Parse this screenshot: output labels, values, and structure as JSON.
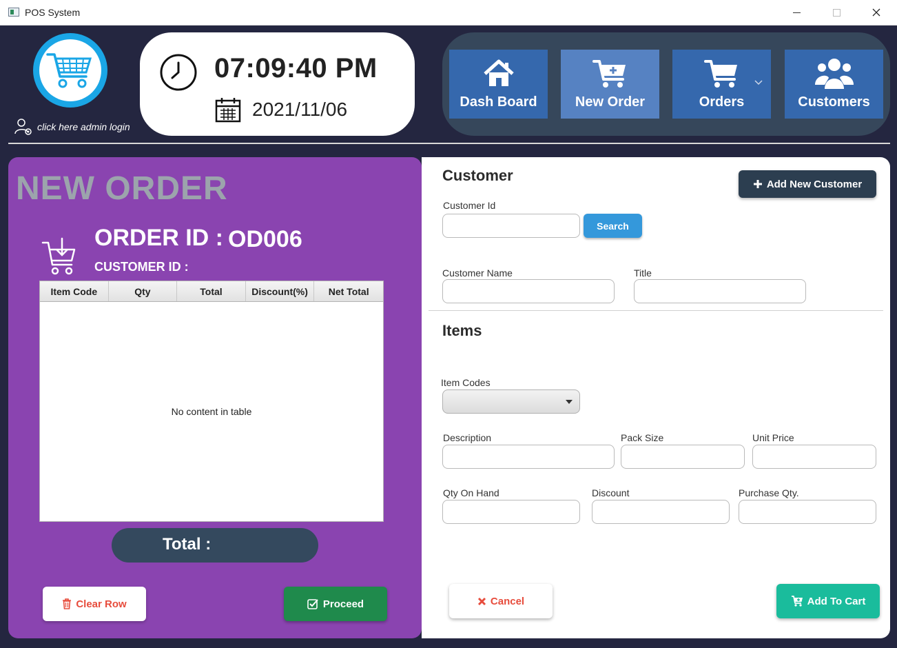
{
  "window": {
    "title": "POS System"
  },
  "header": {
    "admin_link": "click here admin login",
    "time": "07:09:40 PM",
    "date": "2021/11/06"
  },
  "nav": {
    "items": [
      {
        "label": "Dash Board",
        "icon": "home-icon"
      },
      {
        "label": "New Order",
        "icon": "cart-plus-icon",
        "active": true
      },
      {
        "label": "Orders",
        "icon": "cart-icon"
      },
      {
        "label": "Customers",
        "icon": "users-icon"
      }
    ]
  },
  "order": {
    "heading": "NEW ORDER",
    "order_id_label": "ORDER ID :",
    "order_id": "OD006",
    "customer_id_label": "CUSTOMER ID :",
    "table": {
      "columns": [
        "Item Code",
        "Qty",
        "Total",
        "Discount(%)",
        "Net Total"
      ],
      "empty_text": "No content in table"
    },
    "total_label": "Total :",
    "clear_row_label": "Clear Row",
    "proceed_label": "Proceed"
  },
  "customer": {
    "section_title": "Customer",
    "add_new_label": "Add New Customer",
    "customer_id_label": "Customer Id",
    "search_label": "Search",
    "name_label": "Customer Name",
    "title_label": "Title"
  },
  "items": {
    "section_title": "Items",
    "item_codes_label": "Item Codes",
    "description_label": "Description",
    "pack_size_label": "Pack Size",
    "unit_price_label": "Unit Price",
    "qty_on_hand_label": "Qty On Hand",
    "discount_label": "Discount",
    "purchase_qty_label": "Purchase Qty.",
    "cancel_label": "Cancel",
    "add_to_cart_label": "Add To Cart"
  },
  "colors": {
    "background": "#242640",
    "panel_purple": "#8a44b0",
    "nav_button": "#3568ad",
    "nav_active": "#5682c2",
    "accent_blue": "#3498db",
    "dark": "#2c3e50",
    "green": "#1f8a4c",
    "teal": "#1abc9c",
    "red": "#e74c3c"
  }
}
